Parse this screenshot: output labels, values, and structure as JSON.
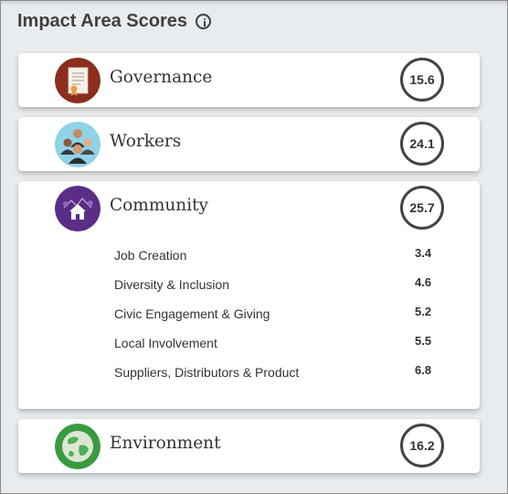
{
  "header": {
    "title": "Impact Area Scores",
    "info_icon": "info-circle-icon"
  },
  "areas": [
    {
      "name": "Governance",
      "score": "15.6",
      "icon": "certificate-document-icon",
      "color": "#8b2e1d"
    },
    {
      "name": "Workers",
      "score": "24.1",
      "icon": "people-group-icon",
      "color": "#8ed3e6"
    },
    {
      "name": "Community",
      "score": "25.7",
      "icon": "community-house-icon",
      "color": "#5a2d87",
      "expanded": true,
      "subscores": [
        {
          "label": "Job Creation",
          "score": "3.4"
        },
        {
          "label": "Diversity & Inclusion",
          "score": "4.6"
        },
        {
          "label": "Civic Engagement & Giving",
          "score": "5.2"
        },
        {
          "label": "Local Involvement",
          "score": "5.5"
        },
        {
          "label": "Suppliers, Distributors & Product",
          "score": "6.8"
        }
      ]
    },
    {
      "name": "Environment",
      "score": "16.2",
      "icon": "globe-earth-icon",
      "color": "#3a9a3f"
    }
  ],
  "colors": {
    "background": "#e9ecef",
    "card": "#ffffff",
    "score_ring": "#444444"
  }
}
